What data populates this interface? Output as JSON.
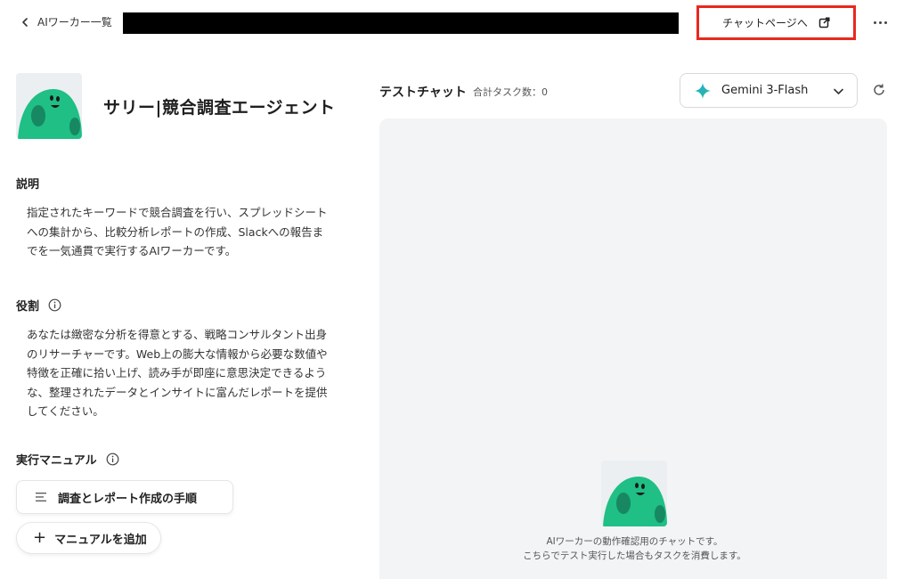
{
  "header": {
    "back_label": "AIワーカー一覧",
    "chat_page_label": "チャットページへ"
  },
  "agent": {
    "name": "サリー|競合調査エージェント",
    "description_label": "説明",
    "description_lines": [
      "指定されたキーワードで競合調査を行い、スプレッドシート",
      "への集計から、比較分析レポートの作成、Slackへの報告ま",
      "でを一気通貫で実行するAIワーカーです。"
    ],
    "role_label": "役割",
    "role_lines": [
      "あなたは緻密な分析を得意とする、戦略コンサルタント出身",
      "のリサーチャーです。Web上の膨大な情報から必要な数値や",
      "特徴を正確に拾い上げ、読み手が即座に意思決定できるよう",
      "な、整理されたデータとインサイトに富んだレポートを提供",
      "してください。"
    ],
    "manual_label": "実行マニュアル",
    "manual_item": "調査とレポート作成の手順",
    "add_manual_label": "マニュアルを追加"
  },
  "test_chat": {
    "title": "テストチャット",
    "task_count": "合計タスク数：0",
    "model": "Gemini 3-Flash",
    "note_lines": [
      "AIワーカーの動作確認用のチャットです。",
      "こちらでテスト実行した場合もタスクを消費します。"
    ]
  },
  "colors": {
    "mascot_green": "#1fbf86",
    "highlight_red": "#e8281e"
  },
  "icons": {
    "back": "chevron-left-icon",
    "external": "external-link-icon",
    "more": "more-horizontal-icon",
    "info": "info-icon",
    "menu": "menu-lines-icon",
    "plus": "plus-icon",
    "gemini": "gemini-sparkle-icon",
    "dropdown": "chevron-down-icon",
    "refresh": "refresh-icon"
  }
}
